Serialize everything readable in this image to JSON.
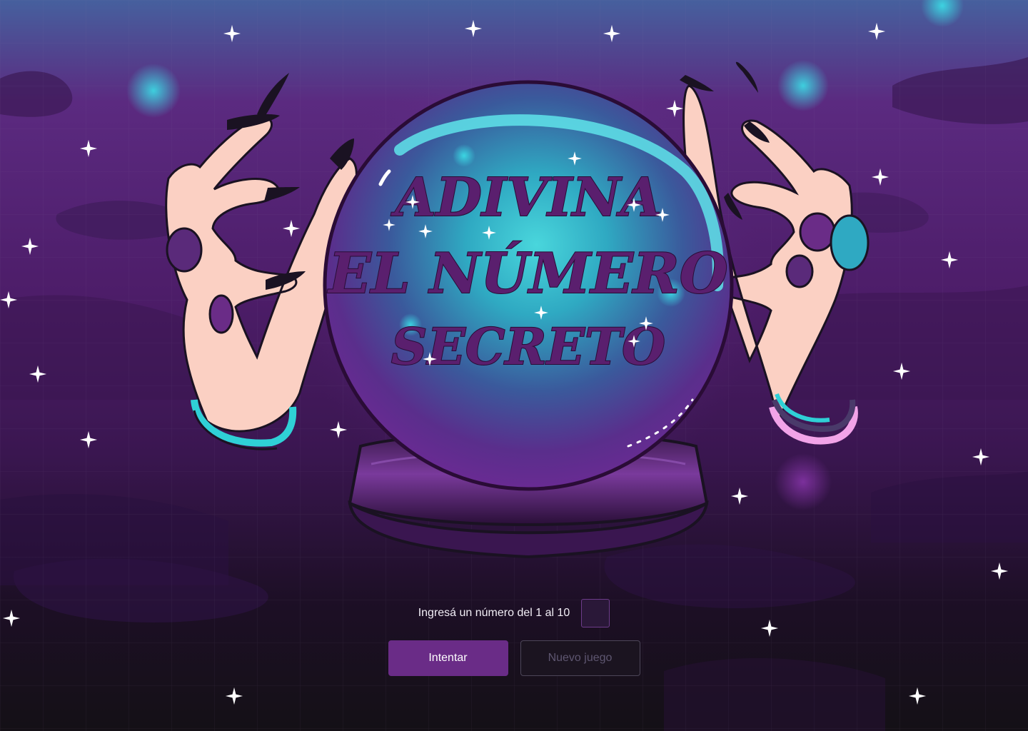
{
  "banner": {
    "title_line1": "ADIVINA",
    "title_line2": "EL NÚMERO",
    "title_line3": "SECRETO"
  },
  "form": {
    "prompt_label": "Ingresá un número del 1 al 10",
    "number_value": "",
    "try_button_label": "Intentar",
    "new_game_button_label": "Nuevo juego"
  },
  "colors": {
    "accent_purple": "#6a2c87",
    "crystal_cyan": "#46d9e0",
    "title_purple": "#5a1f6e",
    "skin_pink": "#fbd0c3",
    "nail_black": "#1a1222"
  }
}
